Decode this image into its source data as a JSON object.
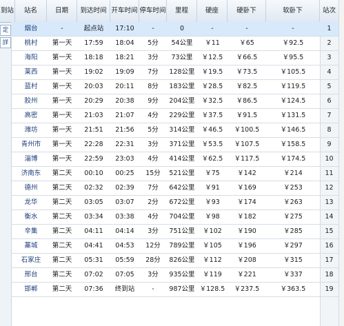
{
  "side_buttons": [
    "定",
    "詳"
  ],
  "headers": {
    "station": "到站",
    "station2": "站名",
    "date": "日期",
    "arrive": "到达时间",
    "depart": "开车时间",
    "stop": "停车时间",
    "mileage": "里程",
    "hard_seat": "硬座",
    "hard_sleeper": "硬卧下",
    "soft_sleeper": "软卧下",
    "stop_no": "站次"
  },
  "rows": [
    {
      "station": "烟台",
      "date": "-",
      "arrive": "起点站",
      "depart": "17:10",
      "stop": "-",
      "mileage": "0",
      "hard_seat": "-",
      "hard_sleeper": "-",
      "soft_sleeper": "-",
      "no": "1"
    },
    {
      "station": "桃村",
      "date": "第一天",
      "arrive": "17:59",
      "depart": "18:04",
      "stop": "5分",
      "mileage": "54公里",
      "hard_seat": "￥11",
      "hard_sleeper": "￥65",
      "soft_sleeper": "￥92.5",
      "no": "2"
    },
    {
      "station": "海阳",
      "date": "第一天",
      "arrive": "18:18",
      "depart": "18:21",
      "stop": "3分",
      "mileage": "73公里",
      "hard_seat": "￥12.5",
      "hard_sleeper": "￥66.5",
      "soft_sleeper": "￥95.5",
      "no": "3"
    },
    {
      "station": "莱西",
      "date": "第一天",
      "arrive": "19:02",
      "depart": "19:09",
      "stop": "7分",
      "mileage": "128公里",
      "hard_seat": "￥19.5",
      "hard_sleeper": "￥73.5",
      "soft_sleeper": "￥105.5",
      "no": "4"
    },
    {
      "station": "蓝村",
      "date": "第一天",
      "arrive": "20:03",
      "depart": "20:11",
      "stop": "8分",
      "mileage": "183公里",
      "hard_seat": "￥28.5",
      "hard_sleeper": "￥82.5",
      "soft_sleeper": "￥119.5",
      "no": "5"
    },
    {
      "station": "胶州",
      "date": "第一天",
      "arrive": "20:29",
      "depart": "20:38",
      "stop": "9分",
      "mileage": "204公里",
      "hard_seat": "￥32.5",
      "hard_sleeper": "￥86.5",
      "soft_sleeper": "￥124.5",
      "no": "6"
    },
    {
      "station": "高密",
      "date": "第一天",
      "arrive": "21:03",
      "depart": "21:07",
      "stop": "4分",
      "mileage": "229公里",
      "hard_seat": "￥37.5",
      "hard_sleeper": "￥91.5",
      "soft_sleeper": "￥131.5",
      "no": "7"
    },
    {
      "station": "潍坊",
      "date": "第一天",
      "arrive": "21:51",
      "depart": "21:56",
      "stop": "5分",
      "mileage": "314公里",
      "hard_seat": "￥46.5",
      "hard_sleeper": "￥100.5",
      "soft_sleeper": "￥146.5",
      "no": "8"
    },
    {
      "station": "青州市",
      "date": "第一天",
      "arrive": "22:28",
      "depart": "22:31",
      "stop": "3分",
      "mileage": "371公里",
      "hard_seat": "￥53.5",
      "hard_sleeper": "￥107.5",
      "soft_sleeper": "￥158.5",
      "no": "9"
    },
    {
      "station": "淄博",
      "date": "第一天",
      "arrive": "22:59",
      "depart": "23:03",
      "stop": "4分",
      "mileage": "414公里",
      "hard_seat": "￥62.5",
      "hard_sleeper": "￥117.5",
      "soft_sleeper": "￥174.5",
      "no": "10"
    },
    {
      "station": "济南东",
      "date": "第二天",
      "arrive": "00:10",
      "depart": "00:25",
      "stop": "15分",
      "mileage": "521公里",
      "hard_seat": "￥75",
      "hard_sleeper": "￥142",
      "soft_sleeper": "￥214",
      "no": "11"
    },
    {
      "station": "德州",
      "date": "第二天",
      "arrive": "02:32",
      "depart": "02:39",
      "stop": "7分",
      "mileage": "642公里",
      "hard_seat": "￥91",
      "hard_sleeper": "￥169",
      "soft_sleeper": "￥253",
      "no": "12"
    },
    {
      "station": "龙华",
      "date": "第二天",
      "arrive": "03:05",
      "depart": "03:07",
      "stop": "2分",
      "mileage": "672公里",
      "hard_seat": "￥93",
      "hard_sleeper": "￥174",
      "soft_sleeper": "￥263",
      "no": "13"
    },
    {
      "station": "衡水",
      "date": "第二天",
      "arrive": "03:34",
      "depart": "03:38",
      "stop": "4分",
      "mileage": "704公里",
      "hard_seat": "￥98",
      "hard_sleeper": "￥182",
      "soft_sleeper": "￥275",
      "no": "14"
    },
    {
      "station": "辛集",
      "date": "第二天",
      "arrive": "04:11",
      "depart": "04:14",
      "stop": "3分",
      "mileage": "751公里",
      "hard_seat": "￥102",
      "hard_sleeper": "￥190",
      "soft_sleeper": "￥285",
      "no": "15"
    },
    {
      "station": "藁城",
      "date": "第二天",
      "arrive": "04:41",
      "depart": "04:53",
      "stop": "12分",
      "mileage": "789公里",
      "hard_seat": "￥105",
      "hard_sleeper": "￥196",
      "soft_sleeper": "￥297",
      "no": "16"
    },
    {
      "station": "石家庄",
      "date": "第二天",
      "arrive": "05:31",
      "depart": "05:59",
      "stop": "28分",
      "mileage": "826公里",
      "hard_seat": "￥112",
      "hard_sleeper": "￥208",
      "soft_sleeper": "￥315",
      "no": "17"
    },
    {
      "station": "邢台",
      "date": "第二天",
      "arrive": "07:02",
      "depart": "07:05",
      "stop": "3分",
      "mileage": "935公里",
      "hard_seat": "￥119",
      "hard_sleeper": "￥221",
      "soft_sleeper": "￥337",
      "no": "18"
    },
    {
      "station": "邯郸",
      "date": "第二天",
      "arrive": "07:36",
      "depart": "终到站",
      "stop": "-",
      "mileage": "987公里",
      "hard_seat": "￥128.5",
      "hard_sleeper": "￥237.5",
      "soft_sleeper": "￥363.5",
      "no": "19"
    }
  ]
}
